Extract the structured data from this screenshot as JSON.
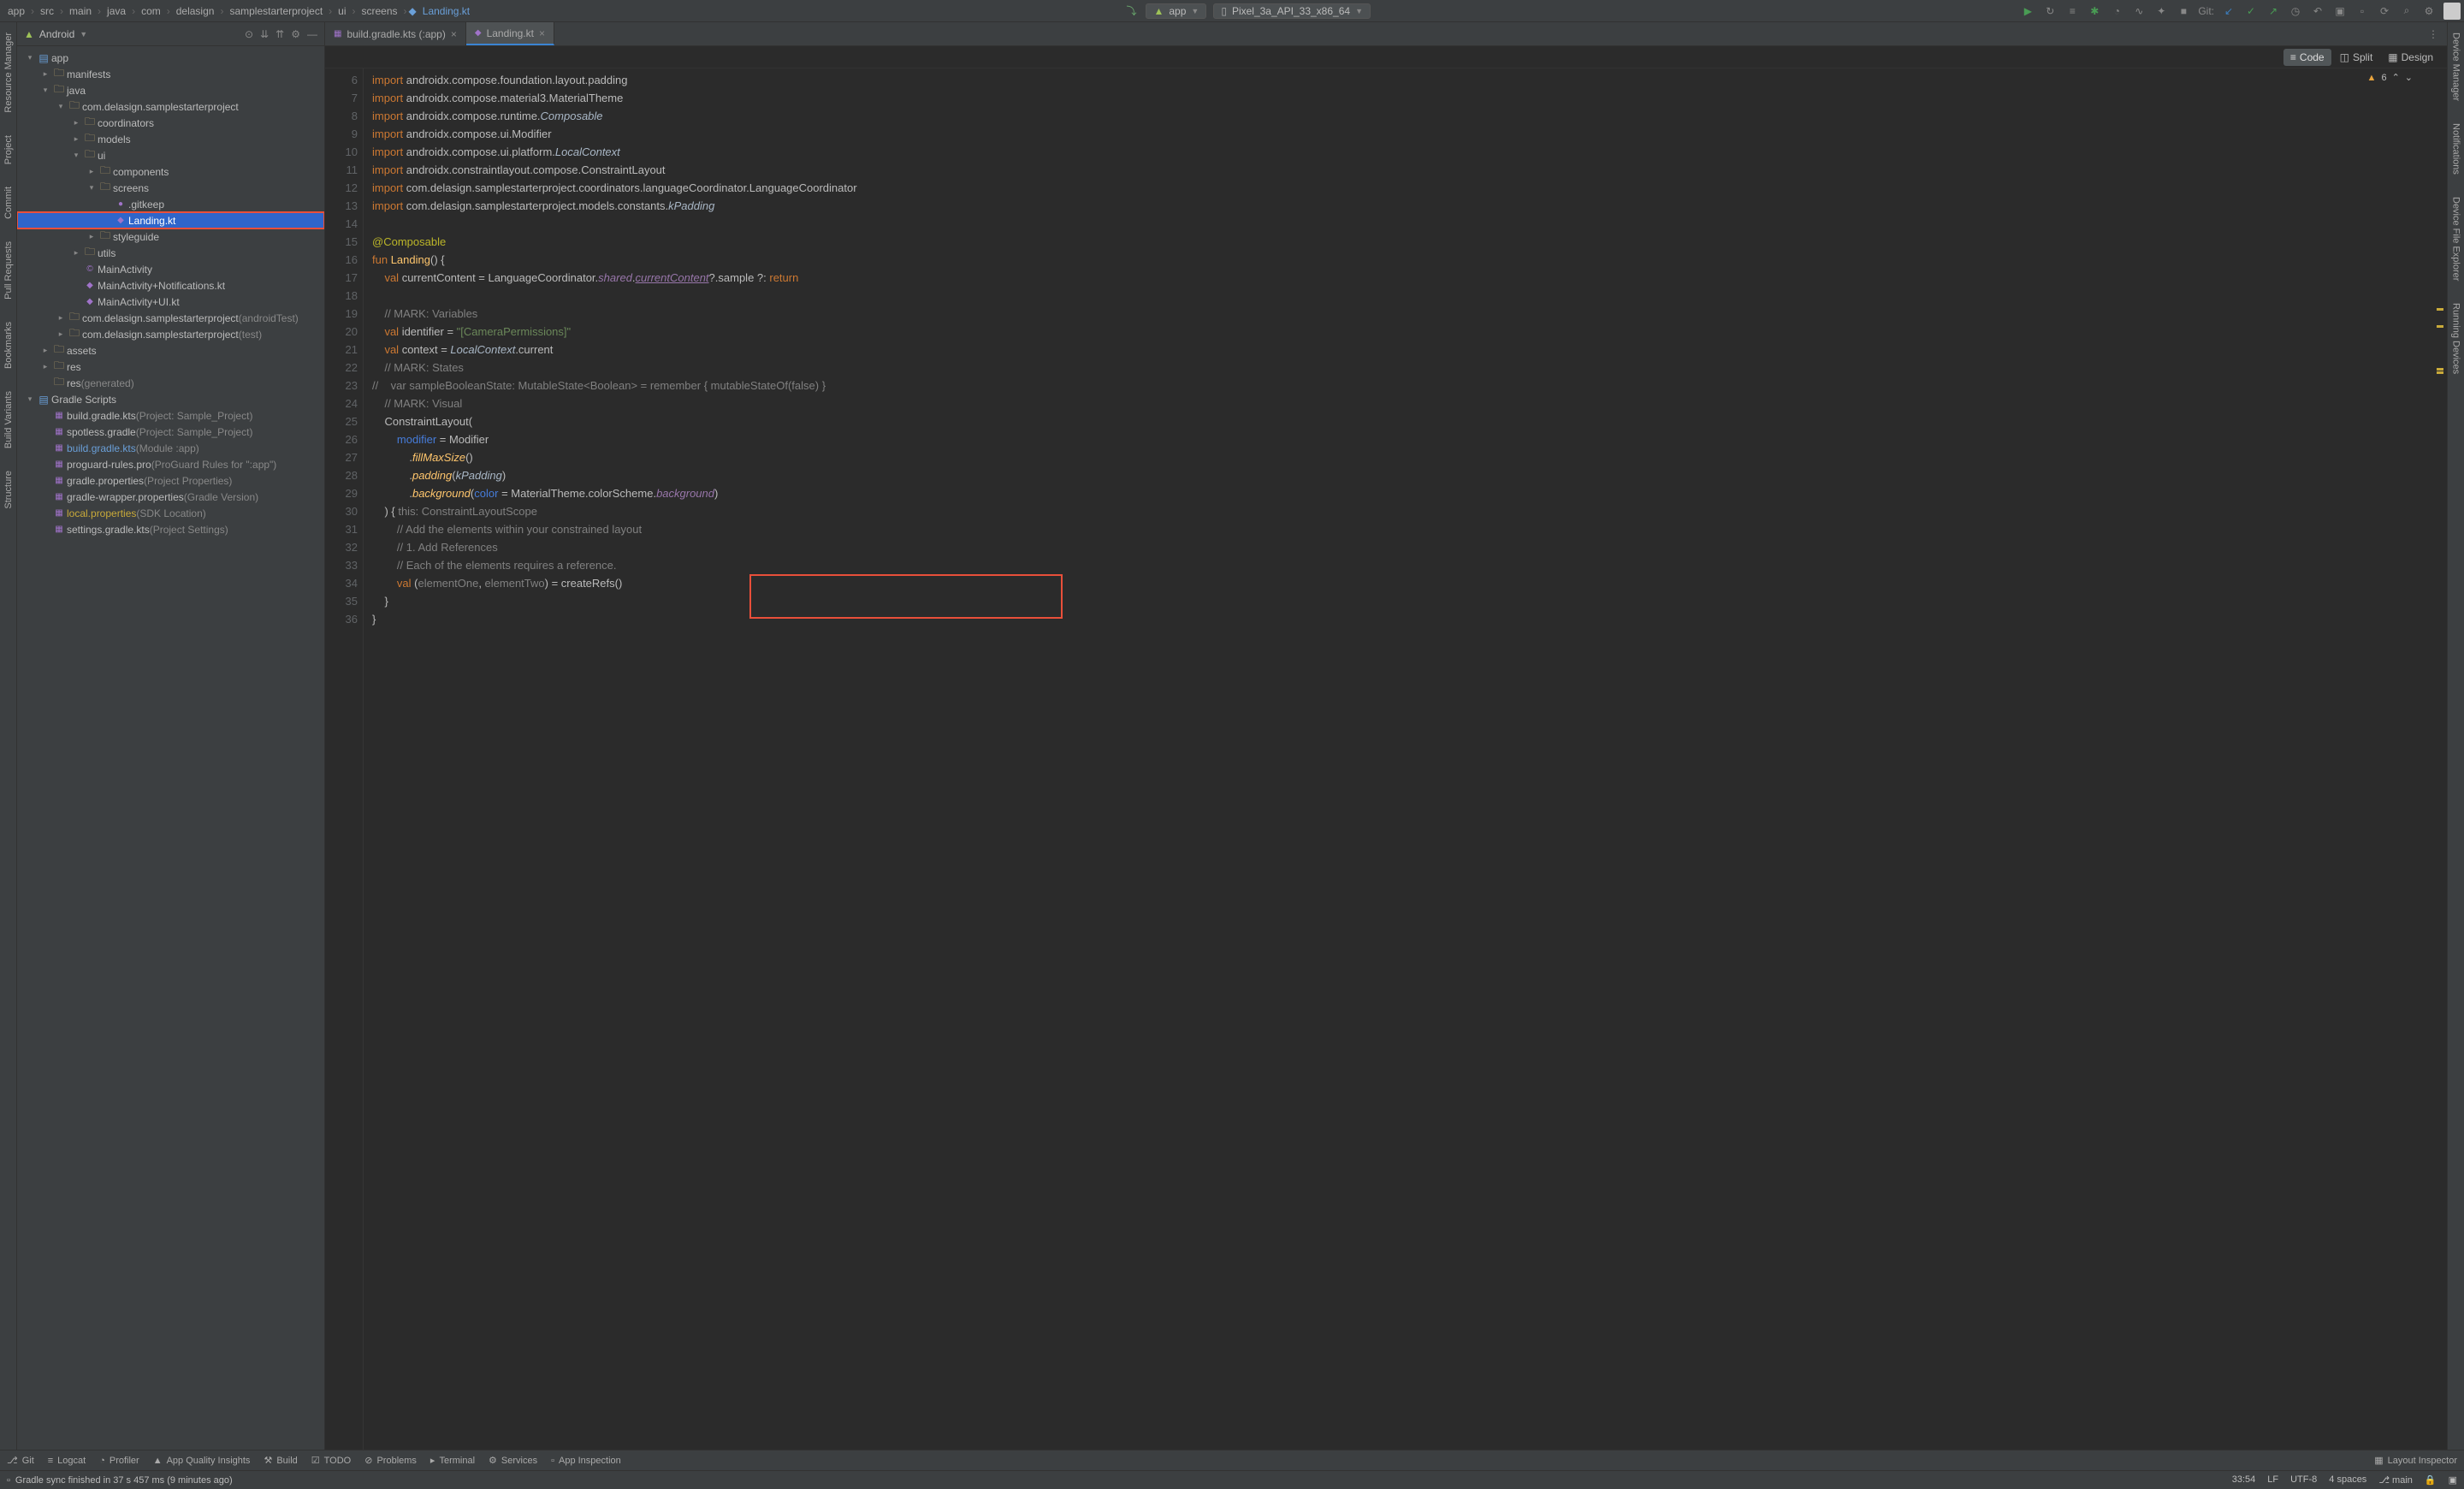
{
  "breadcrumb": [
    "app",
    "src",
    "main",
    "java",
    "com",
    "delasign",
    "samplestarterproject",
    "ui",
    "screens"
  ],
  "breadcrumb_file": "Landing.kt",
  "run_config": {
    "app": "app",
    "device": "Pixel_3a_API_33_x86_64"
  },
  "git_label": "Git:",
  "sidebar": {
    "title": "Android",
    "tree": [
      {
        "indent": 0,
        "chev": "▾",
        "iconClass": "module-icon",
        "iconChar": "▤",
        "text": "app"
      },
      {
        "indent": 1,
        "chev": "▸",
        "iconClass": "folder-icon",
        "iconChar": "🗀",
        "text": "manifests"
      },
      {
        "indent": 1,
        "chev": "▾",
        "iconClass": "folder-icon",
        "iconChar": "🗀",
        "text": "java"
      },
      {
        "indent": 2,
        "chev": "▾",
        "iconClass": "folder-icon",
        "iconChar": "🗀",
        "text": "com.delasign.samplestarterproject"
      },
      {
        "indent": 3,
        "chev": "▸",
        "iconClass": "folder-icon",
        "iconChar": "🗀",
        "text": "coordinators"
      },
      {
        "indent": 3,
        "chev": "▸",
        "iconClass": "folder-icon",
        "iconChar": "🗀",
        "text": "models"
      },
      {
        "indent": 3,
        "chev": "▾",
        "iconClass": "folder-icon",
        "iconChar": "🗀",
        "text": "ui"
      },
      {
        "indent": 4,
        "chev": "▸",
        "iconClass": "folder-icon",
        "iconChar": "🗀",
        "text": "components"
      },
      {
        "indent": 4,
        "chev": "▾",
        "iconClass": "folder-icon",
        "iconChar": "🗀",
        "text": "screens"
      },
      {
        "indent": 5,
        "chev": "",
        "iconClass": "kt-icon",
        "iconChar": "●",
        "text": ".gitkeep"
      },
      {
        "indent": 5,
        "chev": "",
        "iconClass": "kt-icon",
        "iconChar": "◆",
        "text": "Landing.kt",
        "selected": true,
        "highlighted": true
      },
      {
        "indent": 4,
        "chev": "▸",
        "iconClass": "folder-icon",
        "iconChar": "🗀",
        "text": "styleguide"
      },
      {
        "indent": 3,
        "chev": "▸",
        "iconClass": "folder-icon",
        "iconChar": "🗀",
        "text": "utils"
      },
      {
        "indent": 3,
        "chev": "",
        "iconClass": "kt-icon",
        "iconChar": "©",
        "text": "MainActivity"
      },
      {
        "indent": 3,
        "chev": "",
        "iconClass": "kt-icon",
        "iconChar": "◆",
        "text": "MainActivity+Notifications.kt"
      },
      {
        "indent": 3,
        "chev": "",
        "iconClass": "kt-icon",
        "iconChar": "◆",
        "text": "MainActivity+UI.kt"
      },
      {
        "indent": 2,
        "chev": "▸",
        "iconClass": "folder-icon",
        "iconChar": "🗀",
        "text": "com.delasign.samplestarterproject",
        "dim": "(androidTest)"
      },
      {
        "indent": 2,
        "chev": "▸",
        "iconClass": "folder-icon",
        "iconChar": "🗀",
        "text": "com.delasign.samplestarterproject",
        "dim": "(test)"
      },
      {
        "indent": 1,
        "chev": "▸",
        "iconClass": "folder-icon",
        "iconChar": "🗀",
        "text": "assets"
      },
      {
        "indent": 1,
        "chev": "▸",
        "iconClass": "folder-icon",
        "iconChar": "🗀",
        "text": "res"
      },
      {
        "indent": 1,
        "chev": "",
        "iconClass": "folder-icon",
        "iconChar": "🗀",
        "text": "res",
        "dim": "(generated)"
      },
      {
        "indent": 0,
        "chev": "▾",
        "iconClass": "module-icon",
        "iconChar": "▤",
        "text": "Gradle Scripts"
      },
      {
        "indent": 1,
        "chev": "",
        "iconClass": "kt-icon",
        "iconChar": "▦",
        "text": "build.gradle.kts",
        "dim": "(Project: Sample_Project)"
      },
      {
        "indent": 1,
        "chev": "",
        "iconClass": "kt-icon",
        "iconChar": "▦",
        "text": "spotless.gradle",
        "dim": "(Project: Sample_Project)"
      },
      {
        "indent": 1,
        "chev": "",
        "iconClass": "kt-icon",
        "iconChar": "▦",
        "text": "build.gradle.kts",
        "dim": "(Module :app)",
        "blue": true
      },
      {
        "indent": 1,
        "chev": "",
        "iconClass": "kt-icon",
        "iconChar": "▦",
        "text": "proguard-rules.pro",
        "dim": "(ProGuard Rules for \":app\")"
      },
      {
        "indent": 1,
        "chev": "",
        "iconClass": "kt-icon",
        "iconChar": "▦",
        "text": "gradle.properties",
        "dim": "(Project Properties)"
      },
      {
        "indent": 1,
        "chev": "",
        "iconClass": "kt-icon",
        "iconChar": "▦",
        "text": "gradle-wrapper.properties",
        "dim": "(Gradle Version)"
      },
      {
        "indent": 1,
        "chev": "",
        "iconClass": "kt-icon",
        "iconChar": "▦",
        "text": "local.properties",
        "dim": "(SDK Location)",
        "yellow": true
      },
      {
        "indent": 1,
        "chev": "",
        "iconClass": "kt-icon",
        "iconChar": "▦",
        "text": "settings.gradle.kts",
        "dim": "(Project Settings)"
      }
    ]
  },
  "tabs": [
    {
      "label": "build.gradle.kts (:app)",
      "icon": "▦"
    },
    {
      "label": "Landing.kt",
      "icon": "◆",
      "active": true
    }
  ],
  "view_modes": {
    "code": "Code",
    "split": "Split",
    "design": "Design"
  },
  "warning_count": "6",
  "code_lines": [
    {
      "n": 6,
      "html": "<span class='c-keyword'>import</span> androidx.compose.foundation.layout.padding"
    },
    {
      "n": 7,
      "html": "<span class='c-keyword'>import</span> androidx.compose.material3.MaterialTheme"
    },
    {
      "n": 8,
      "html": "<span class='c-keyword'>import</span> androidx.compose.runtime.<span class='c-ital'>Composable</span>"
    },
    {
      "n": 9,
      "html": "<span class='c-keyword'>import</span> androidx.compose.ui.Modifier"
    },
    {
      "n": 10,
      "html": "<span class='c-keyword'>import</span> androidx.compose.ui.platform.<span class='c-ital'>LocalContext</span>"
    },
    {
      "n": 11,
      "html": "<span class='c-keyword'>import</span> androidx.constraintlayout.compose.ConstraintLayout"
    },
    {
      "n": 12,
      "html": "<span class='c-keyword'>import</span> com.delasign.samplestarterproject.coordinators.languageCoordinator.LanguageCoordinator"
    },
    {
      "n": 13,
      "html": "<span class='c-keyword'>import</span> com.delasign.samplestarterproject.models.constants.<span class='c-ital'>kPadding</span>"
    },
    {
      "n": 14,
      "html": ""
    },
    {
      "n": 15,
      "html": "<span class='c-annotation'>@Composable</span>"
    },
    {
      "n": 16,
      "html": "<span class='c-keyword'>fun</span> <span class='c-func' style='font-style:normal'>Landing</span>() {"
    },
    {
      "n": 17,
      "html": "    <span class='c-keyword'>val</span> currentContent = LanguageCoordinator.<span class='c-member'>shared</span>.<span class='c-member' style='text-decoration:underline'>currentContent</span>?.sample ?: <span class='c-keyword'>return</span>"
    },
    {
      "n": 18,
      "html": ""
    },
    {
      "n": 19,
      "html": "    <span class='c-comment'>// MARK: Variables</span>"
    },
    {
      "n": 20,
      "html": "    <span class='c-keyword'>val</span> identifier = <span class='c-string'>\"[CameraPermissions]\"</span>"
    },
    {
      "n": 21,
      "html": "    <span class='c-keyword'>val</span> context = <span class='c-ital'>LocalContext</span>.current"
    },
    {
      "n": 22,
      "html": "    <span class='c-comment'>// MARK: States</span>"
    },
    {
      "n": 23,
      "html": "<span class='c-comment'>//    var sampleBooleanState: MutableState&lt;Boolean&gt; = remember { mutableStateOf(false) }</span>"
    },
    {
      "n": 24,
      "html": "    <span class='c-comment'>// MARK: Visual</span>"
    },
    {
      "n": 25,
      "html": "    ConstraintLayout("
    },
    {
      "n": 26,
      "html": "        <span class='c-param'>modifier</span> = Modifier"
    },
    {
      "n": 27,
      "html": "            .<span class='c-func'>fillMaxSize</span>()"
    },
    {
      "n": 28,
      "html": "            .<span class='c-func'>padding</span>(<span class='c-ital'>kPadding</span>)"
    },
    {
      "n": 29,
      "html": "            .<span class='c-func'>background</span>(<span class='c-param'>color</span> = MaterialTheme.colorScheme.<span class='c-member'>background</span>)"
    },
    {
      "n": 30,
      "html": "    ) { <span class='c-comment' style='font-style:normal'>this: ConstraintLayoutScope</span>"
    },
    {
      "n": 31,
      "html": "        <span class='c-comment'>// Add the elements within your constrained layout</span>"
    },
    {
      "n": 32,
      "html": "        <span class='c-comment'>// 1. Add References</span>"
    },
    {
      "n": 33,
      "html": "        <span class='c-comment'>// Each of the elements requires a reference.</span>"
    },
    {
      "n": 34,
      "html": "        <span class='c-keyword'>val</span> (<span style='color:#808080'>elementOne</span>, <span style='color:#808080'>elementTwo</span>) = createRefs()"
    },
    {
      "n": 35,
      "html": "    }"
    },
    {
      "n": 36,
      "html": "}"
    }
  ],
  "left_rail": [
    "Resource Manager",
    "Project",
    "Commit",
    "Pull Requests",
    "Bookmarks",
    "Build Variants",
    "Structure"
  ],
  "right_rail": [
    "Device Manager",
    "Notifications",
    "Device File Explorer",
    "Running Devices"
  ],
  "bottom_tabs": [
    "Git",
    "Logcat",
    "Profiler",
    "App Quality Insights",
    "Build",
    "TODO",
    "Problems",
    "Terminal",
    "Services",
    "App Inspection"
  ],
  "bottom_right": "Layout Inspector",
  "status": {
    "sync": "Gradle sync finished in 37 s 457 ms (9 minutes ago)",
    "pos": "33:54",
    "lf": "LF",
    "enc": "UTF-8",
    "indent": "4 spaces",
    "branch": "main"
  }
}
